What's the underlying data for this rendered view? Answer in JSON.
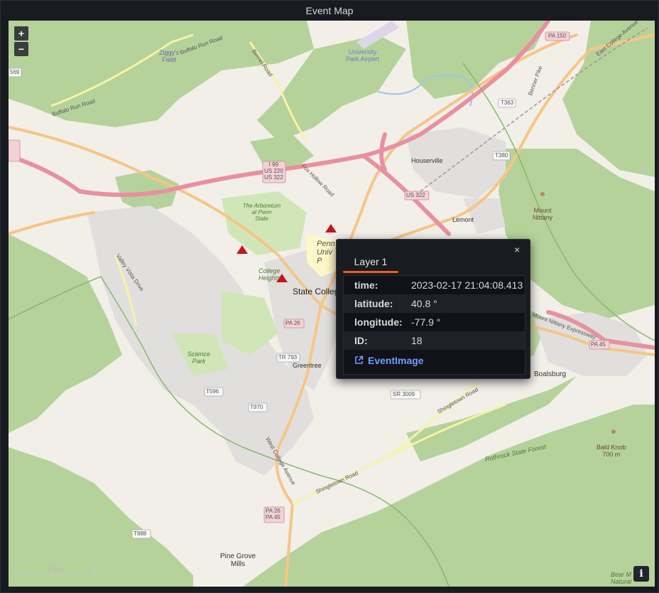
{
  "panel": {
    "title": "Event Map"
  },
  "map": {
    "zoom_in": "+",
    "zoom_out": "−",
    "scale_label": "2 km",
    "info_label": "i",
    "place_labels": {
      "ziggy": "Ziggy's\nField",
      "airport": "University\nPark Airport",
      "houserville": "Houserville",
      "lemont": "Lemont",
      "mount_nittany": "Mount\nNittany",
      "state_college": "State College",
      "penn_state": "Penn\nUniv\nP",
      "arboretum": "The Arboretum\nat Penn\nState",
      "college_heights": "College\nHeights",
      "science_park": "Science\nPark",
      "greentree": "Greentree",
      "boalsburg": "Boalsburg",
      "pine_grove": "Pine Grove\nMills",
      "bald_knob": "Bald Knob\n700 m",
      "rothrock": "Rothrock State Forest",
      "bear": "Bear M\nNatural"
    },
    "road_labels": {
      "pa150": "PA 150",
      "t363": "T363",
      "t380": "T380",
      "i99": "I 99\nUS 220\nUS 322",
      "us322": "US 322",
      "pa26": "PA 26",
      "pa45": "PA 45",
      "tr793": "TR 793",
      "t596": "T596",
      "t970": "T970",
      "sr3009": "SR 3009",
      "pa26_45": "PA 26\nPA 45",
      "t888": "T888",
      "s569": "569",
      "buffalo_run": "Buffalo Run Road",
      "buffalo_run2": "Buffalo Run Road",
      "bernel": "Bernel Road",
      "fox_hollow": "Fox Hollow Road",
      "valley_vista": "Valley Vista Drive",
      "shingletown": "Shingletown Road",
      "shingletown2": "Shingletown Road",
      "west_college": "West College Avenue",
      "east_college": "East College Avenue",
      "mt_nittany_expy": "Mount Nittany Expressway",
      "benner": "Benner Pike"
    },
    "markers": [
      {
        "name": "event-marker-1",
        "color": "#c4161c"
      },
      {
        "name": "event-marker-2",
        "color": "#c4161c"
      },
      {
        "name": "event-marker-3",
        "color": "#c4161c"
      }
    ]
  },
  "popup": {
    "tab_label": "Layer 1",
    "close_label": "×",
    "rows": [
      {
        "key": "time:",
        "value": "2023-02-17 21:04:08.413"
      },
      {
        "key": "latitude:",
        "value": "40.8 °"
      },
      {
        "key": "longitude:",
        "value": "-77.9 °"
      },
      {
        "key": "ID:",
        "value": "18"
      }
    ],
    "link_label": "EventImage"
  },
  "colors": {
    "forest": "#a9cf8a",
    "forest_dark": "#94c27a",
    "motorway": "#e8909f",
    "primary": "#f5c07a",
    "urban": "#dcdcdc",
    "link": "#6e9fff",
    "accent": "#f05a28"
  }
}
